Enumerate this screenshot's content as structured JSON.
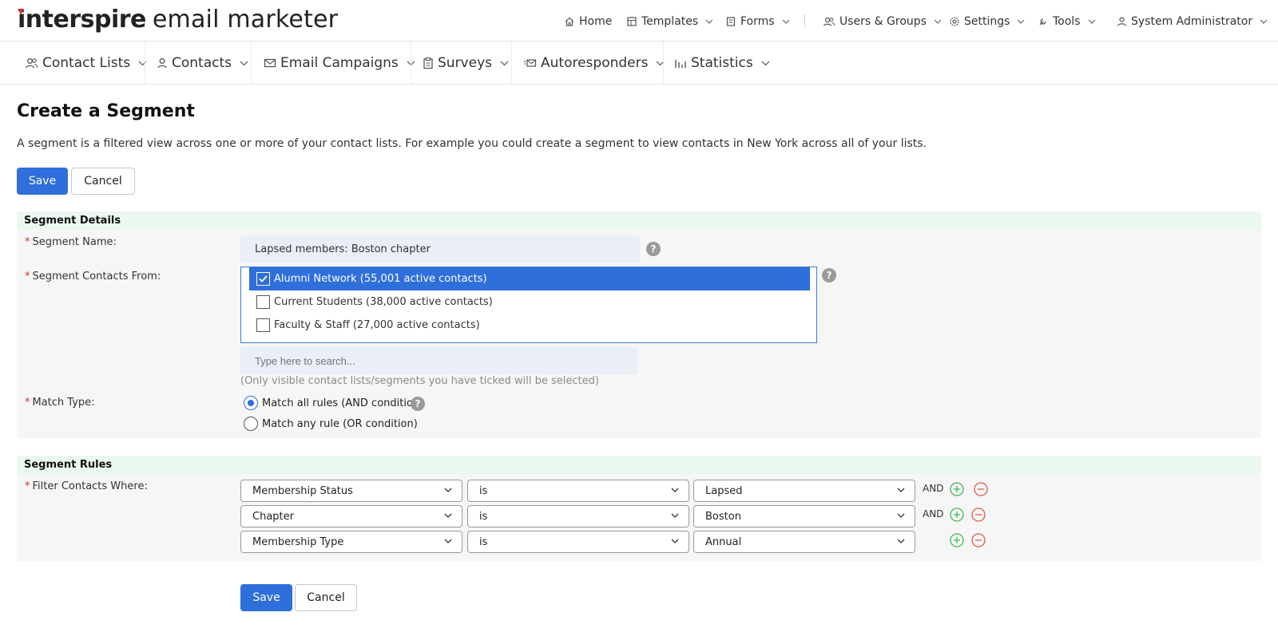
{
  "logo": {
    "brand": "interspire",
    "rest": "email marketer"
  },
  "topnav": {
    "home": "Home",
    "templates": "Templates",
    "forms": "Forms",
    "users_groups": "Users & Groups",
    "settings": "Settings",
    "tools": "Tools",
    "user": "System Administrator"
  },
  "mainnav": {
    "contact_lists": "Contact Lists",
    "contacts": "Contacts",
    "email_campaigns": "Email Campaigns",
    "surveys": "Surveys",
    "autoresponders": "Autoresponders",
    "statistics": "Statistics"
  },
  "page": {
    "title": "Create a Segment",
    "description": "A segment is a filtered view across one or more of your contact lists. For example you could create a segment to view contacts in New York across all of your lists."
  },
  "buttons": {
    "save": "Save",
    "cancel": "Cancel"
  },
  "details": {
    "heading": "Segment Details",
    "required_mark": "*",
    "name_label": "Segment Name:",
    "name_value": "Lapsed members: Boston chapter",
    "from_label": "Segment Contacts From:",
    "lists": [
      {
        "label": "Alumni Network (55,001 active contacts)",
        "checked": true
      },
      {
        "label": "Current Students (38,000 active contacts)",
        "checked": false
      },
      {
        "label": "Faculty & Staff (27,000 active contacts)",
        "checked": false
      }
    ],
    "search_placeholder": "Type here to search...",
    "hint": "(Only visible contact lists/segments you have ticked will be selected)",
    "match_label": "Match Type:",
    "match_all": "Match all rules (AND condition)",
    "match_any": "Match any rule (OR condition)",
    "match_selected": "all",
    "help_glyph": "?"
  },
  "rules": {
    "heading": "Segment Rules",
    "filter_label": "Filter Contacts Where:",
    "connector": "AND",
    "rows": [
      {
        "field": "Membership Status",
        "operator": "is",
        "value": "Lapsed",
        "connector": "AND"
      },
      {
        "field": "Chapter",
        "operator": "is",
        "value": "Boston",
        "connector": "AND"
      },
      {
        "field": "Membership Type",
        "operator": "is",
        "value": "Annual",
        "connector": ""
      }
    ]
  },
  "colors": {
    "primary": "#2e6fdb",
    "required": "#d0312d",
    "section_head": "#eaf8ef",
    "add": "#3fb55b",
    "remove": "#e2574c"
  }
}
